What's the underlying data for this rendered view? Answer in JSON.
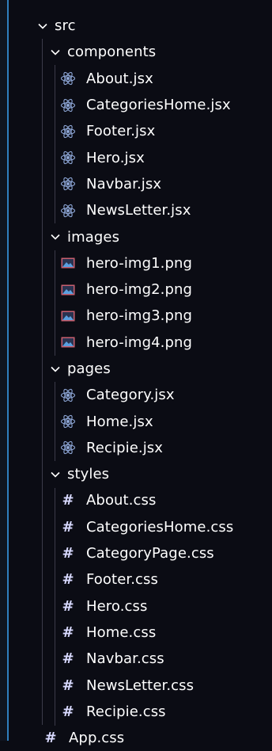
{
  "explorer": {
    "root": {
      "label": "src",
      "icon": "chevron-down-icon"
    },
    "folders": [
      {
        "label": "components",
        "icon": "chevron-down-icon",
        "files": [
          {
            "label": "About.jsx",
            "icon": "react-icon"
          },
          {
            "label": "CategoriesHome.jsx",
            "icon": "react-icon"
          },
          {
            "label": "Footer.jsx",
            "icon": "react-icon"
          },
          {
            "label": "Hero.jsx",
            "icon": "react-icon"
          },
          {
            "label": "Navbar.jsx",
            "icon": "react-icon"
          },
          {
            "label": "NewsLetter.jsx",
            "icon": "react-icon"
          }
        ]
      },
      {
        "label": "images",
        "icon": "chevron-down-icon",
        "files": [
          {
            "label": "hero-img1.png",
            "icon": "image-file-icon"
          },
          {
            "label": "hero-img2.png",
            "icon": "image-file-icon"
          },
          {
            "label": "hero-img3.png",
            "icon": "image-file-icon"
          },
          {
            "label": "hero-img4.png",
            "icon": "image-file-icon"
          }
        ]
      },
      {
        "label": "pages",
        "icon": "chevron-down-icon",
        "files": [
          {
            "label": "Category.jsx",
            "icon": "react-icon"
          },
          {
            "label": "Home.jsx",
            "icon": "react-icon"
          },
          {
            "label": "Recipie.jsx",
            "icon": "react-icon"
          }
        ]
      },
      {
        "label": "styles",
        "icon": "chevron-down-icon",
        "files": [
          {
            "label": "About.css",
            "icon": "css-hash-icon",
            "glyph": "#"
          },
          {
            "label": "CategoriesHome.css",
            "icon": "css-hash-icon",
            "glyph": "#"
          },
          {
            "label": "CategoryPage.css",
            "icon": "css-hash-icon",
            "glyph": "#"
          },
          {
            "label": "Footer.css",
            "icon": "css-hash-icon",
            "glyph": "#"
          },
          {
            "label": "Hero.css",
            "icon": "css-hash-icon",
            "glyph": "#"
          },
          {
            "label": "Home.css",
            "icon": "css-hash-icon",
            "glyph": "#"
          },
          {
            "label": "Navbar.css",
            "icon": "css-hash-icon",
            "glyph": "#"
          },
          {
            "label": "NewsLetter.css",
            "icon": "css-hash-icon",
            "glyph": "#"
          },
          {
            "label": "Recipie.css",
            "icon": "css-hash-icon",
            "glyph": "#"
          }
        ]
      }
    ],
    "root_files": [
      {
        "label": "App.css",
        "icon": "css-hash-icon",
        "glyph": "#"
      }
    ]
  },
  "colors": {
    "background": "#0b0c14",
    "text": "#ffffff",
    "react_icon": "#8fa8d8",
    "image_icon_bg": "#c86070",
    "image_icon_fg": "#5aa0e0",
    "css_hash": "#d8d9ff",
    "indent_guide": "#3b3b4a",
    "frame_edge": "#2f7fbf"
  }
}
